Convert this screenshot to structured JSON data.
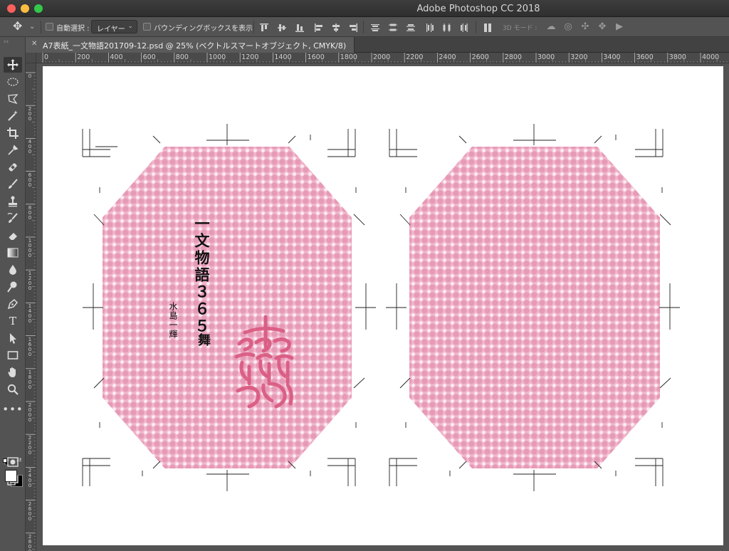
{
  "window": {
    "app_title": "Adobe Photoshop CC 2018"
  },
  "options_bar": {
    "auto_select_label": "自動選択 :",
    "auto_select_target": "レイヤー",
    "show_transform_label": "バウンディングボックスを表示",
    "mode_3d_label": "3D モード :"
  },
  "document": {
    "tab_title": "A7表紙_一文物語201709-12.psd @ 25% (ベクトルスマートオブジェクト, CMYK/8)"
  },
  "rulers": {
    "horizontal": [
      "0",
      "200",
      "400",
      "600",
      "800",
      "1000",
      "1200",
      "1400",
      "1600",
      "1800",
      "2000",
      "2200",
      "2400",
      "2600",
      "2800",
      "3000",
      "3200",
      "3400",
      "3600",
      "3800",
      "4000"
    ],
    "vertical": [
      "0",
      "200",
      "400",
      "600",
      "800",
      "1000",
      "1200",
      "1400",
      "1600",
      "1800",
      "2000",
      "2200",
      "2400",
      "2600",
      "2800"
    ]
  },
  "artwork": {
    "title": "一文物語３６５",
    "subtitle": "舞",
    "author": "水島一輝",
    "cover_color": "#f2b7cd",
    "seal_color": "#d9577f"
  },
  "colors": {
    "foreground": "#ffffff",
    "background": "#000000"
  }
}
